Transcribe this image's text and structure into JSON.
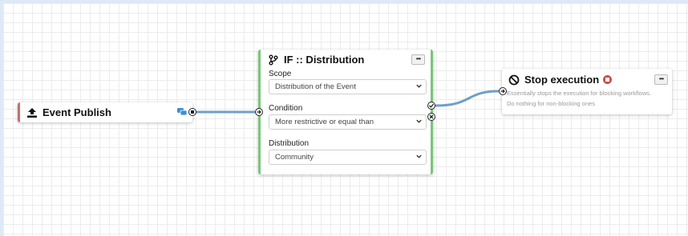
{
  "nodes": {
    "event_publish": {
      "title": "Event Publish"
    },
    "if_node": {
      "title": "IF :: Distribution",
      "menu_label": "•••",
      "fields": [
        {
          "label": "Scope",
          "value": "Distribution of the Event"
        },
        {
          "label": "Condition",
          "value": "More restrictive or equal than"
        },
        {
          "label": "Distribution",
          "value": "Community"
        }
      ]
    },
    "stop_execution": {
      "title": "Stop execution",
      "menu_label": "•••",
      "description": [
        "Essentially stops the execution for blocking workflows.",
        "Do nothing for non-blocking ones"
      ]
    }
  },
  "colors": {
    "wire": "#6f9fc8",
    "trigger_accent": "#c46f6f",
    "condition_accent": "#7cc47a",
    "stop_badge": "#c94c4c",
    "grid_line": "#ececec"
  },
  "icons": [
    "upload-icon",
    "chat-bubbles-icon",
    "branch-icon",
    "ban-icon",
    "stop-circle-icon",
    "chevron-down-icon",
    "arrow-right-circle-icon",
    "check-circle-icon",
    "x-circle-icon"
  ]
}
